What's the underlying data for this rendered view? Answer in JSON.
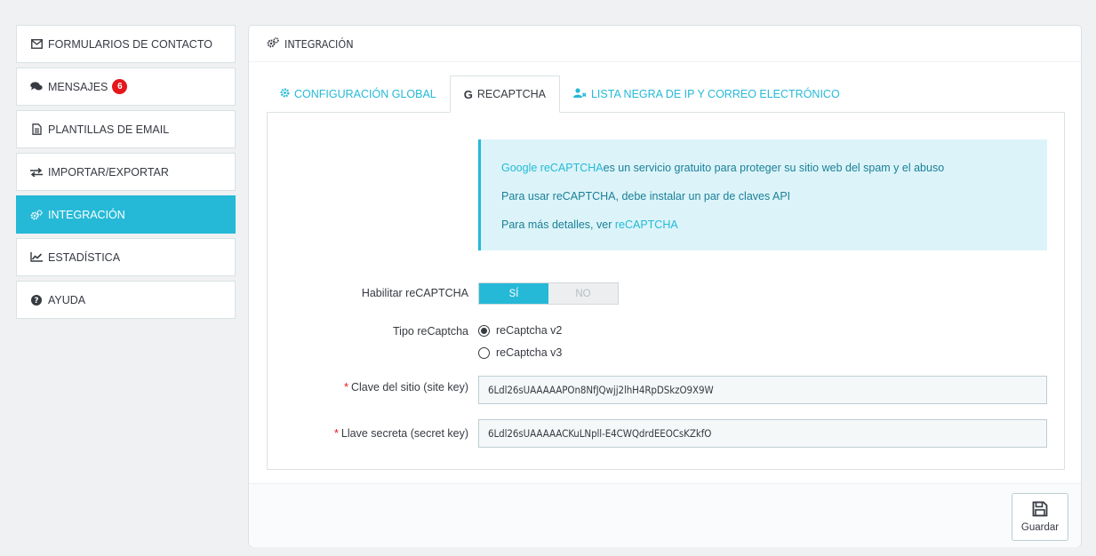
{
  "sidebar": {
    "items": [
      {
        "label": "FORMULARIOS DE CONTACTO",
        "icon": "envelope-icon"
      },
      {
        "label": "MENSAJES",
        "icon": "comments-icon",
        "badge": "6"
      },
      {
        "label": "PLANTILLAS DE EMAIL",
        "icon": "document-icon"
      },
      {
        "label": "IMPORTAR/EXPORTAR",
        "icon": "exchange-icon"
      },
      {
        "label": "INTEGRACIÓN",
        "icon": "gears-icon",
        "active": true
      },
      {
        "label": "ESTADÍSTICA",
        "icon": "line-chart-icon"
      },
      {
        "label": "AYUDA",
        "icon": "question-circle-icon"
      }
    ]
  },
  "panel": {
    "title": "INTEGRACIÓN",
    "tabs": [
      {
        "label": "CONFIGURACIÓN GLOBAL",
        "icon": "cog-icon"
      },
      {
        "label": "RECAPTCHA",
        "icon": "google-g-icon",
        "active": true
      },
      {
        "label": "LISTA NEGRA DE IP Y CORREO ELECTRÓNICO",
        "icon": "user-block-icon"
      }
    ]
  },
  "info": {
    "line1_link": "Google reCAPTCHA",
    "line1_text": "es un servicio gratuito para proteger su sitio web del spam y el abuso",
    "line2": "Para usar reCAPTCHA, debe instalar un par de claves API",
    "line3_text": "Para más detalles, ver ",
    "line3_link": "reCAPTCHA"
  },
  "form": {
    "enable_label": "Habilitar reCAPTCHA",
    "switch_on": "SÍ",
    "switch_off": "NO",
    "type_label": "Tipo reCaptcha",
    "type_options": [
      "reCaptcha v2",
      "reCaptcha v3"
    ],
    "type_selected": "reCaptcha v2",
    "site_key_label": "Clave del sitio (site key)",
    "site_key_value": "6Ldl26sUAAAAAPOn8NfJQwjj2lhH4RpDSkzO9X9W",
    "secret_key_label": "Llave secreta (secret key)",
    "secret_key_value": "6Ldl26sUAAAAACKuLNpll-E4CWQdrdEEOCsKZkfO",
    "required_mark": "*"
  },
  "footer": {
    "save_label": "Guardar"
  },
  "colors": {
    "accent": "#25b9d7",
    "badge": "#e5161c",
    "info_bg": "#dcf4f9"
  }
}
